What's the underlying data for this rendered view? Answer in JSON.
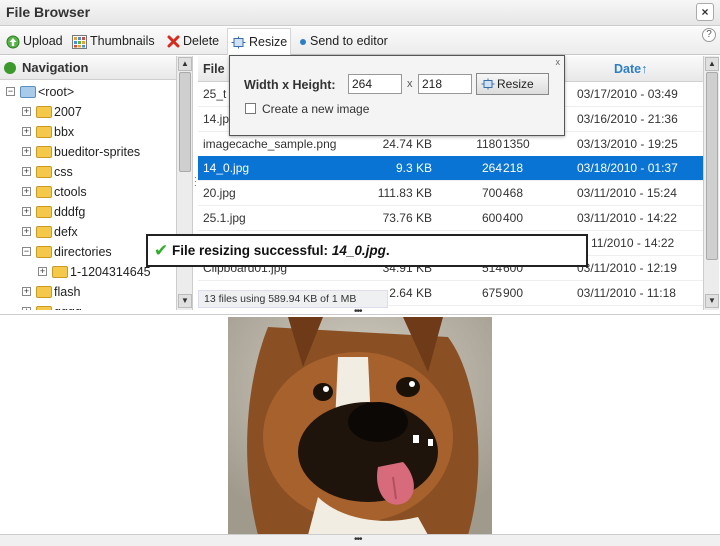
{
  "window": {
    "title": "File Browser",
    "close": "×"
  },
  "toolbar": {
    "upload": "Upload",
    "thumbnails": "Thumbnails",
    "delete": "Delete",
    "resize": "Resize",
    "send_to_editor": "Send to editor",
    "help": "?"
  },
  "nav": {
    "heading": "Navigation",
    "root": "<root>",
    "folders": [
      {
        "label": "2007",
        "expander": "+"
      },
      {
        "label": "bbx",
        "expander": "+"
      },
      {
        "label": "bueditor-sprites",
        "expander": "+"
      },
      {
        "label": "css",
        "expander": "+"
      },
      {
        "label": "ctools",
        "expander": "+"
      },
      {
        "label": "dddfg",
        "expander": "+"
      },
      {
        "label": "defx",
        "expander": "+"
      },
      {
        "label": "directories",
        "expander": "−"
      },
      {
        "label": "1-1204314645",
        "expander": "+"
      },
      {
        "label": "flash",
        "expander": "+"
      },
      {
        "label": "gggg",
        "expander": "+"
      }
    ]
  },
  "files": {
    "col_file": "File",
    "col_date": "Date↑",
    "rows": [
      {
        "name": "25_t",
        "size": "",
        "w": "",
        "h": "",
        "date": "03/17/2010 - 03:49"
      },
      {
        "name": "14.jp",
        "size": "",
        "w": "",
        "h": "",
        "date": "03/16/2010 - 21:36"
      },
      {
        "name": "imagecache_sample.png",
        "size": "24.74 KB",
        "w": "1180",
        "h": "1350",
        "date": "03/13/2010 - 19:25"
      },
      {
        "name": "14_0.jpg",
        "size": "9.3 KB",
        "w": "264",
        "h": "218",
        "date": "03/18/2010 - 01:37"
      },
      {
        "name": "20.jpg",
        "size": "111.83 KB",
        "w": "700",
        "h": "468",
        "date": "03/11/2010 - 15:24"
      },
      {
        "name": "25.1.jpg",
        "size": "73.76 KB",
        "w": "600",
        "h": "400",
        "date": "03/11/2010 - 14:22"
      },
      {
        "name": "",
        "size": "",
        "w": "",
        "h": "",
        "date": "11/2010 - 14:22"
      },
      {
        "name": "Clipboard01.jpg",
        "size": "34.91 KB",
        "w": "514",
        "h": "600",
        "date": "03/11/2010 - 12:19"
      },
      {
        "name": "",
        "size": "2.64 KB",
        "w": "675",
        "h": "900",
        "date": "03/11/2010 - 11:18"
      }
    ],
    "status": "13 files using 589.94 KB of 1 MB"
  },
  "resize_popup": {
    "label": "Width x Height:",
    "width": "264",
    "separator": "x",
    "height": "218",
    "button": "Resize",
    "create_new": "Create a new image",
    "close": "x"
  },
  "toast": {
    "message": "File resizing successful:",
    "file": "14_0.jpg",
    "period": "."
  }
}
